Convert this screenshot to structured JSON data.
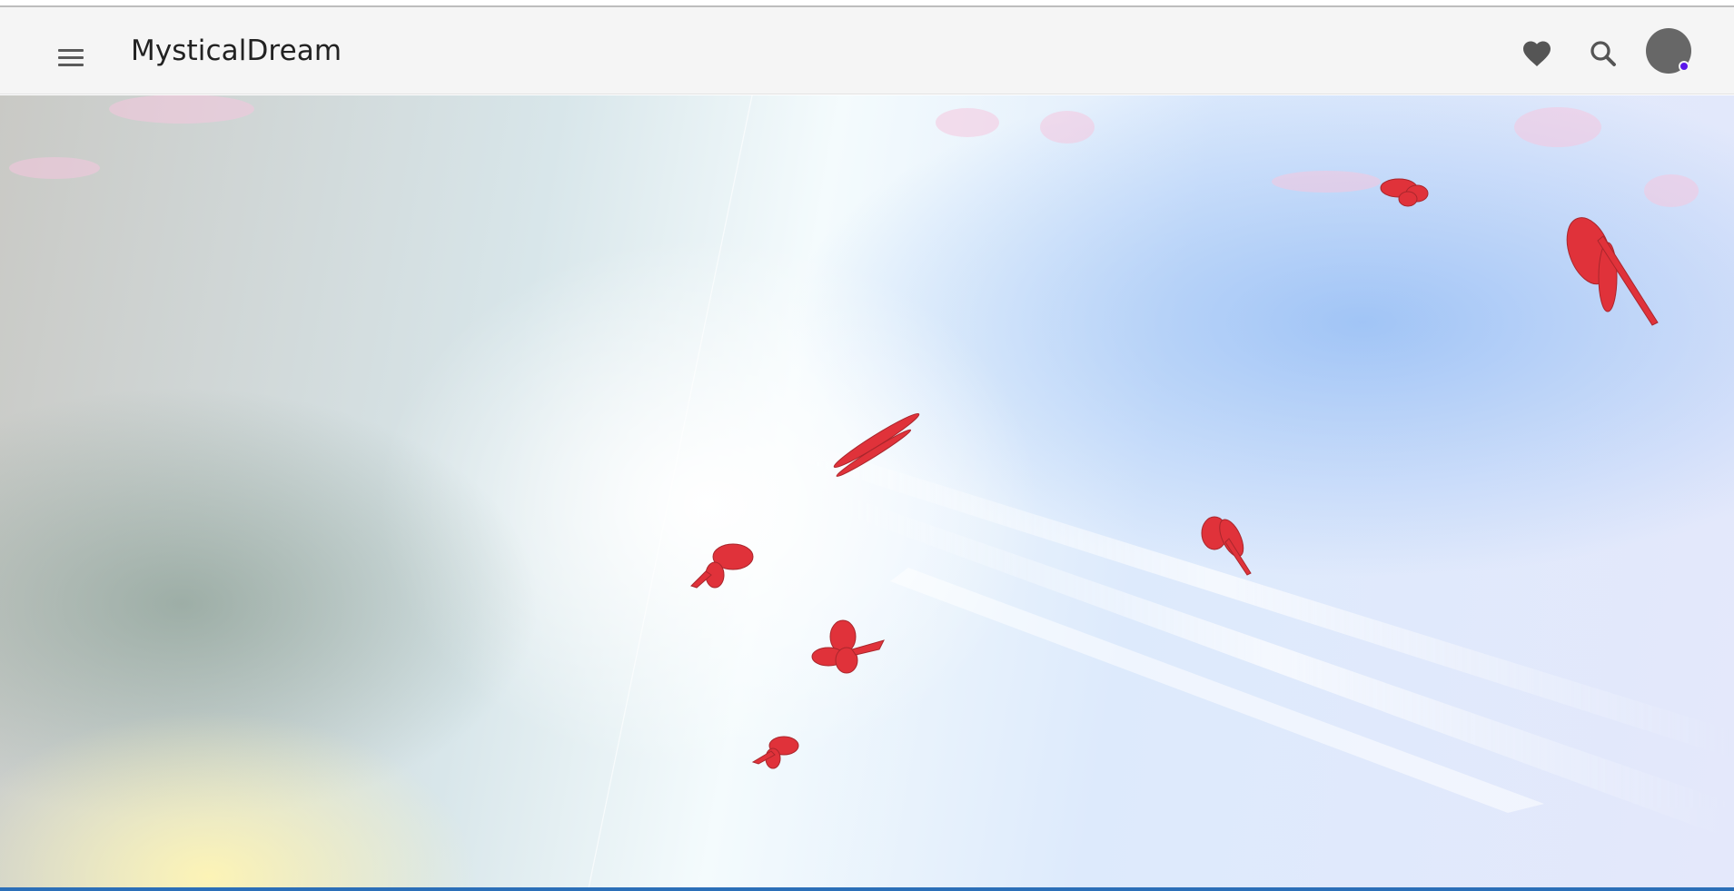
{
  "app": {
    "title": "MysticalDream"
  },
  "header": {
    "menu_icon": "hamburger-menu-icon",
    "favorites_icon": "heart-icon",
    "search_icon": "search-icon",
    "avatar_status_color": "#5b17ea"
  },
  "scene": {
    "description_icon": "butterfly-icon",
    "butterfly_color": "#e0323a"
  }
}
